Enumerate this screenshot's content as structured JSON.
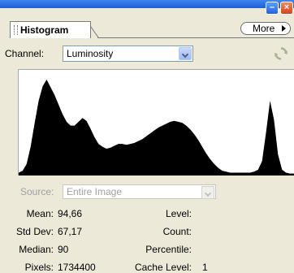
{
  "window": {
    "minimize_glyph": "–",
    "close_glyph": "×"
  },
  "panel": {
    "tab_title": "Histogram",
    "more_label": "More"
  },
  "channel": {
    "label": "Channel:",
    "value": "Luminosity"
  },
  "source": {
    "label": "Source:",
    "value": "Entire Image"
  },
  "stats_left": [
    {
      "label": "Mean:",
      "value": "94,66"
    },
    {
      "label": "Std Dev:",
      "value": "67,17"
    },
    {
      "label": "Median:",
      "value": "90"
    },
    {
      "label": "Pixels:",
      "value": "1734400"
    }
  ],
  "stats_right": [
    {
      "label": "Level:",
      "value": ""
    },
    {
      "label": "Count:",
      "value": ""
    },
    {
      "label": "Percentile:",
      "value": ""
    },
    {
      "label": "Cache Level:",
      "value": "1"
    }
  ],
  "histogram": {
    "fill_color": "#000000",
    "levels": [
      0.03,
      0.05,
      0.12,
      0.3,
      0.55,
      0.78,
      0.93,
      1.0,
      0.92,
      0.84,
      0.74,
      0.64,
      0.56,
      0.52,
      0.52,
      0.56,
      0.6,
      0.57,
      0.49,
      0.4,
      0.33,
      0.3,
      0.28,
      0.29,
      0.31,
      0.33,
      0.33,
      0.32,
      0.33,
      0.34,
      0.36,
      0.38,
      0.41,
      0.44,
      0.47,
      0.5,
      0.52,
      0.54,
      0.56,
      0.57,
      0.56,
      0.55,
      0.52,
      0.48,
      0.43,
      0.37,
      0.3,
      0.23,
      0.17,
      0.12,
      0.08,
      0.05,
      0.04,
      0.03,
      0.03,
      0.03,
      0.03,
      0.03,
      0.03,
      0.04,
      0.06,
      0.15,
      0.45,
      0.78,
      0.58,
      0.22,
      0.06,
      0.03,
      0.02,
      0.02
    ]
  },
  "colors": {
    "panel_bg": "#ece9d8",
    "titlebar": "#1d5fd6",
    "disabled_text": "#a0a0a0"
  }
}
